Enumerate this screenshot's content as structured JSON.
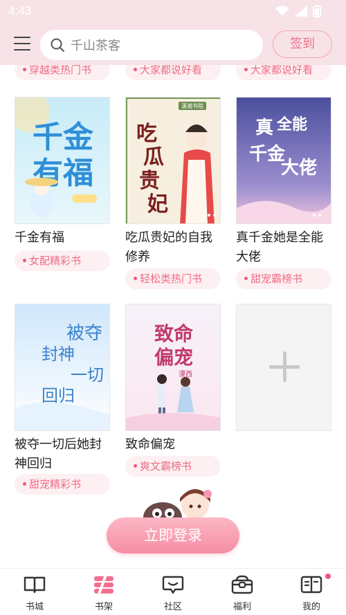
{
  "status": {
    "time": "4:43"
  },
  "header": {
    "search_placeholder": "千山茶客",
    "signin_label": "签到"
  },
  "shelf": {
    "top_row_tags": [
      "穿越类热门书",
      "大家都说好看",
      "大家都说好看"
    ],
    "books": [
      {
        "title": "千金有福",
        "tag": "女配精彩书",
        "cover_text": "千金有福"
      },
      {
        "title": "吃瓜贵妃的自我修养",
        "tag": "轻松类热门书",
        "cover_text": "吃瓜贵妃",
        "cover_badge": "潇湘书院"
      },
      {
        "title": "真千金她是全能大佬",
        "tag": "甜宠霸榜书",
        "cover_text": "真千金她是全能大佬"
      },
      {
        "title": "被夺一切后她封神回归",
        "tag": "甜宠精彩书",
        "cover_text": "被夺一切封神回归"
      },
      {
        "title": "致命偏宠",
        "tag": "爽文霸榜书",
        "cover_text": "致命偏宠",
        "cover_author": "漫西"
      }
    ]
  },
  "login": {
    "button_label": "立即登录"
  },
  "tabs": [
    {
      "label": "书城",
      "icon": "book-open-icon"
    },
    {
      "label": "书架",
      "icon": "bookshelf-icon",
      "active": true
    },
    {
      "label": "社区",
      "icon": "chat-bubble-icon"
    },
    {
      "label": "福利",
      "icon": "gift-box-icon"
    },
    {
      "label": "我的",
      "icon": "profile-book-icon",
      "badge": true
    }
  ],
  "colors": {
    "accent": "#ee6b84",
    "header_bg": "#f7e3e7",
    "login_button": "#f68da3"
  }
}
